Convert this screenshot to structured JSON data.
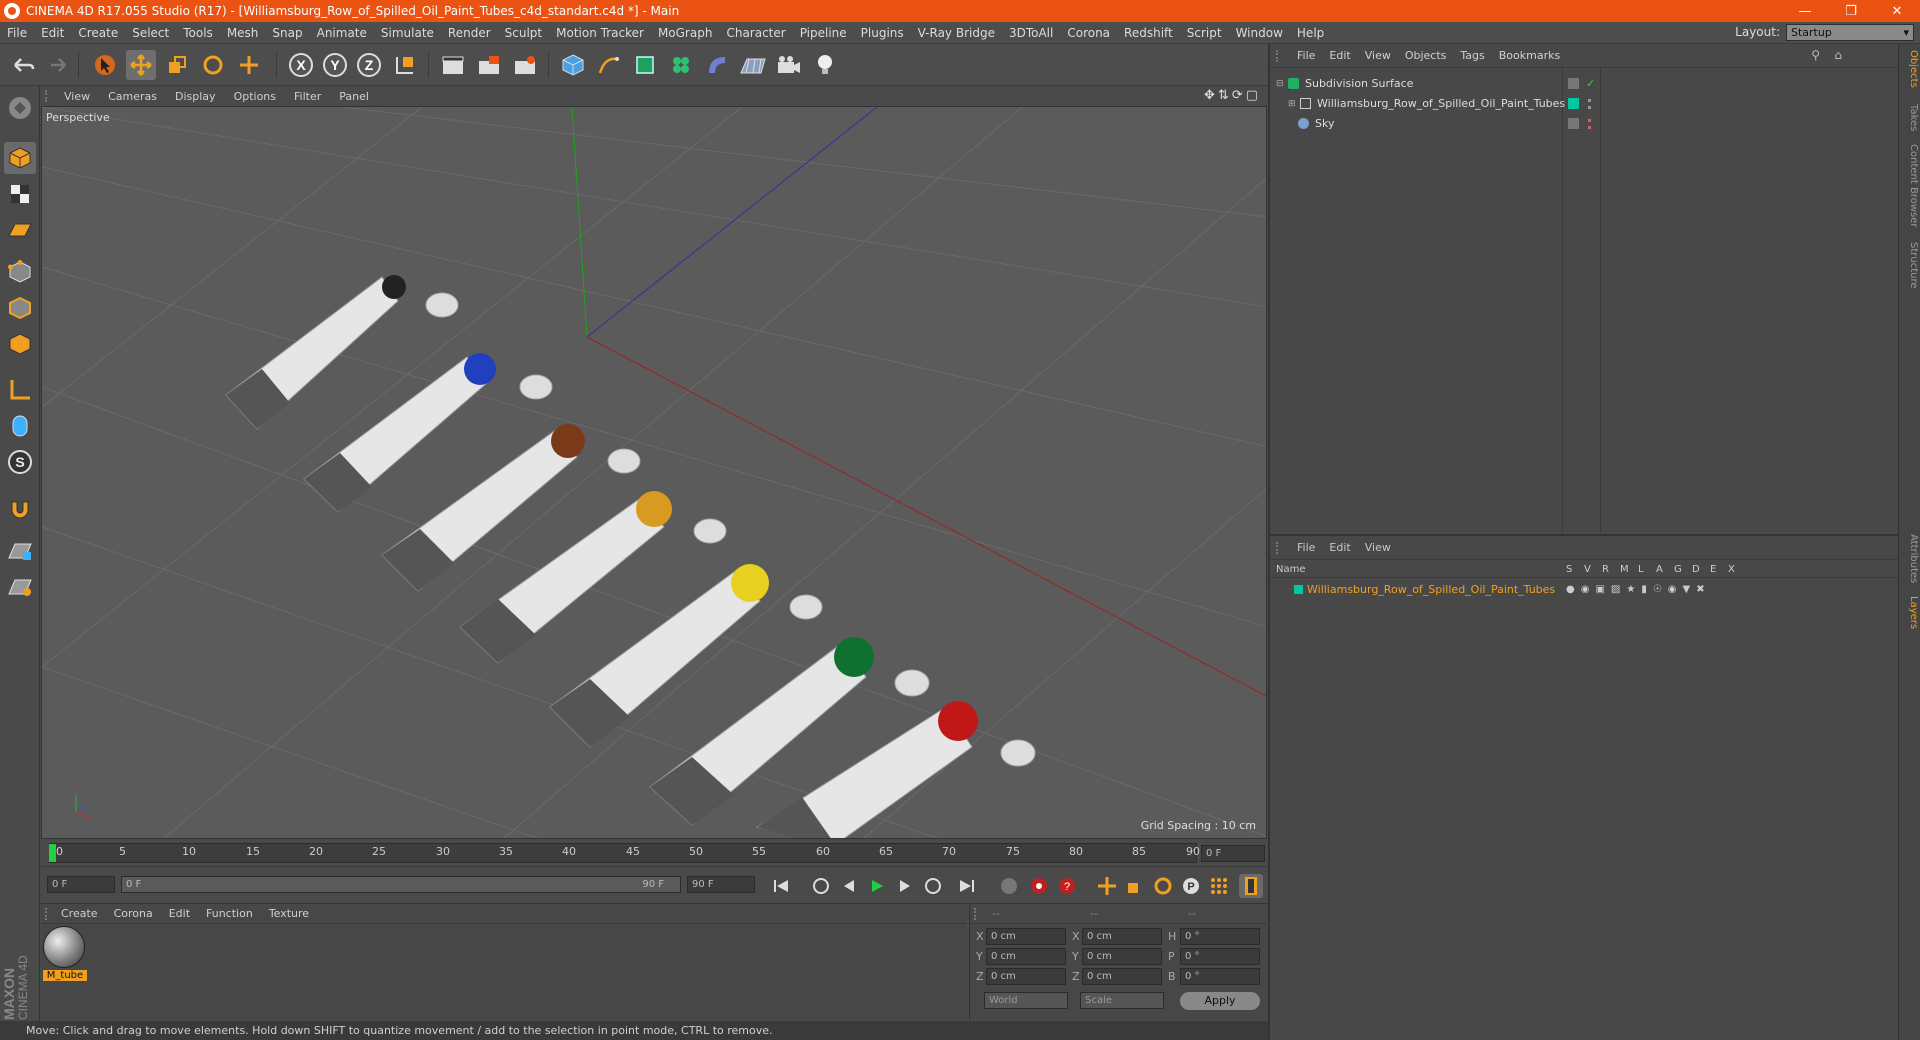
{
  "window": {
    "title": "CINEMA 4D R17.055 Studio (R17) - [Williamsburg_Row_of_Spilled_Oil_Paint_Tubes_c4d_standart.c4d *] - Main"
  },
  "menu": [
    "File",
    "Edit",
    "Create",
    "Select",
    "Tools",
    "Mesh",
    "Snap",
    "Animate",
    "Simulate",
    "Render",
    "Sculpt",
    "Motion Tracker",
    "MoGraph",
    "Character",
    "Pipeline",
    "Plugins",
    "V-Ray Bridge",
    "3DToAll",
    "Corona",
    "Redshift",
    "Script",
    "Window",
    "Help"
  ],
  "layout": {
    "label": "Layout:",
    "value": "Startup"
  },
  "viewport": {
    "menu": [
      "View",
      "Cameras",
      "Display",
      "Options",
      "Filter",
      "Panel"
    ],
    "label": "Perspective",
    "grid_spacing": "Grid Spacing : 10 cm"
  },
  "timeline": {
    "ticks": [
      "0",
      "5",
      "10",
      "15",
      "20",
      "25",
      "30",
      "35",
      "40",
      "45",
      "50",
      "55",
      "60",
      "65",
      "70",
      "75",
      "80",
      "85",
      "90"
    ],
    "end_field": "0 F"
  },
  "anim": {
    "start": "0 F",
    "range_start": "0 F",
    "range_end": "90 F",
    "end": "90 F"
  },
  "material": {
    "menu": [
      "Create",
      "Corona",
      "Edit",
      "Function",
      "Texture"
    ],
    "items": [
      {
        "name": "M_tube"
      }
    ]
  },
  "coords": {
    "header": [
      "--",
      "--",
      "--"
    ],
    "rows": [
      {
        "a": "X",
        "av": "0 cm",
        "b": "X",
        "bv": "0 cm",
        "c": "H",
        "cv": "0 °"
      },
      {
        "a": "Y",
        "av": "0 cm",
        "b": "Y",
        "bv": "0 cm",
        "c": "P",
        "cv": "0 °"
      },
      {
        "a": "Z",
        "av": "0 cm",
        "b": "Z",
        "bv": "0 cm",
        "c": "B",
        "cv": "0 °"
      }
    ],
    "mode1": "World",
    "mode2": "Scale",
    "apply": "Apply"
  },
  "status": "Move: Click and drag to move elements. Hold down SHIFT to quantize movement / add to the selection in point mode, CTRL to remove.",
  "objects": {
    "menu": [
      "File",
      "Edit",
      "View",
      "Objects",
      "Tags",
      "Bookmarks"
    ],
    "items": [
      {
        "name": "Subdivision Surface"
      },
      {
        "name": "Williamsburg_Row_of_Spilled_Oil_Paint_Tubes"
      },
      {
        "name": "Sky"
      }
    ]
  },
  "layers": {
    "menu": [
      "File",
      "Edit",
      "View"
    ],
    "header": {
      "name": "Name",
      "cols": [
        "S",
        "V",
        "R",
        "M",
        "L",
        "A",
        "G",
        "D",
        "E",
        "X"
      ]
    },
    "items": [
      {
        "name": "Williamsburg_Row_of_Spilled_Oil_Paint_Tubes",
        "color": "#00c8a0"
      }
    ]
  },
  "sidetabs": [
    "Objects",
    "Takes",
    "Content Browser",
    "Structure",
    "Attributes",
    "Layers"
  ],
  "brand": {
    "line1": "MAXON",
    "line2": "CINEMA 4D"
  },
  "colors": {
    "accent": "#ea5311",
    "selected_text": "#f0a020",
    "layer_green": "#00c8a0"
  }
}
